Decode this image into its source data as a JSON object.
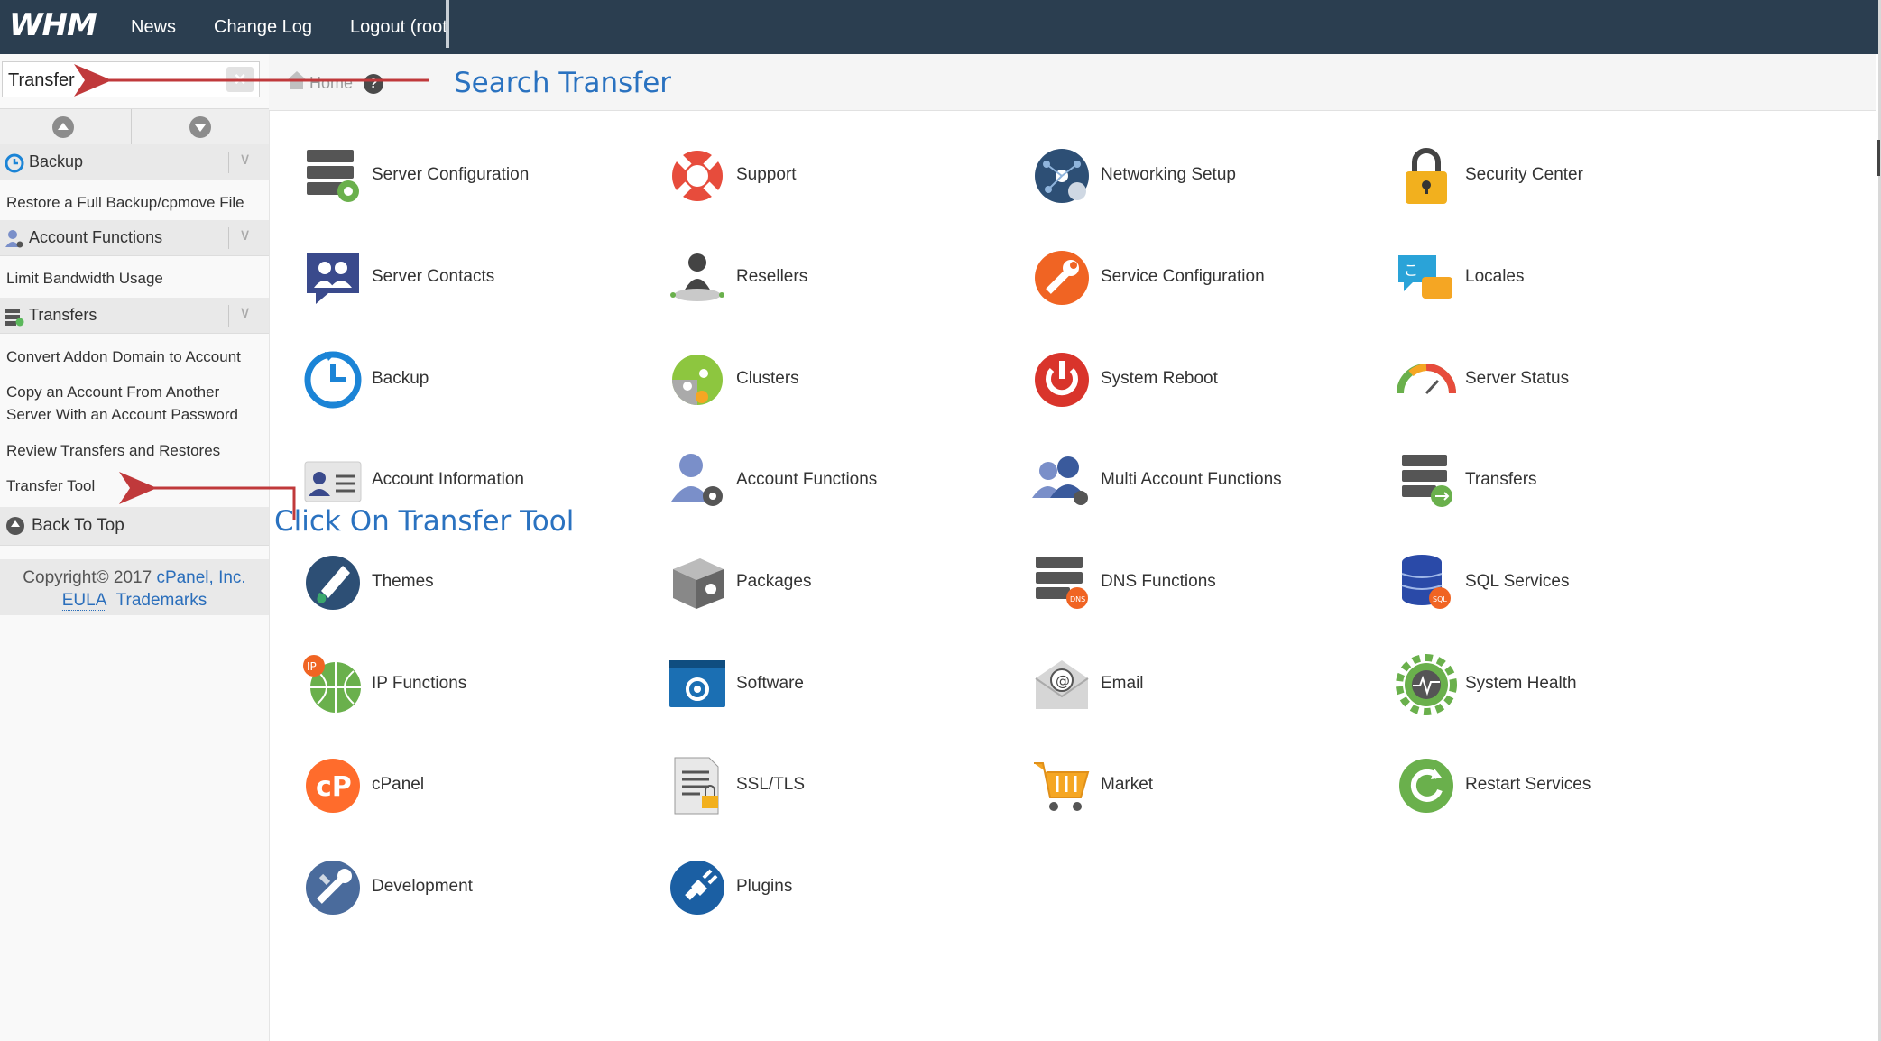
{
  "topbar": {
    "logo": "WHM",
    "nav": [
      "News",
      "Change Log",
      "Logout (root"
    ]
  },
  "search": {
    "value": "Transfer"
  },
  "sidebar": {
    "categories": [
      {
        "label": "Backup",
        "icon": "backup-clock-icon",
        "items": [
          "Restore a Full Backup/cpmove File"
        ]
      },
      {
        "label": "Account Functions",
        "icon": "user-gear-icon",
        "items": [
          "Limit Bandwidth Usage"
        ]
      },
      {
        "label": "Transfers",
        "icon": "transfers-server-icon",
        "items": [
          "Convert Addon Domain to Account",
          "Copy an Account From Another Server With an Account Password",
          "Review Transfers and Restores",
          "Transfer Tool"
        ]
      }
    ],
    "back_to_top": "Back To Top",
    "copyright_text": "Copyright© 2017",
    "copyright_company": "cPanel, Inc.",
    "eula": "EULA",
    "trademarks": "Trademarks"
  },
  "breadcrumb": {
    "home": "Home",
    "help": "?"
  },
  "annotations": {
    "search_hint": "Search Transfer",
    "click_hint": "Click On Transfer Tool"
  },
  "grid": [
    {
      "label": "Server Configuration",
      "icon": "server-gear-icon"
    },
    {
      "label": "Support",
      "icon": "lifebuoy-icon"
    },
    {
      "label": "Networking Setup",
      "icon": "network-globe-icon"
    },
    {
      "label": "Security Center",
      "icon": "padlock-icon"
    },
    {
      "label": "Server Contacts",
      "icon": "contacts-chat-icon"
    },
    {
      "label": "Resellers",
      "icon": "reseller-user-icon"
    },
    {
      "label": "Service Configuration",
      "icon": "wrench-icon"
    },
    {
      "label": "Locales",
      "icon": "locales-speech-icon"
    },
    {
      "label": "Backup",
      "icon": "backup-clock-icon"
    },
    {
      "label": "Clusters",
      "icon": "clusters-icon"
    },
    {
      "label": "System Reboot",
      "icon": "power-icon"
    },
    {
      "label": "Server Status",
      "icon": "gauge-icon"
    },
    {
      "label": "Account Information",
      "icon": "id-card-icon"
    },
    {
      "label": "Account Functions",
      "icon": "user-gear-icon"
    },
    {
      "label": "Multi Account Functions",
      "icon": "users-gear-icon"
    },
    {
      "label": "Transfers",
      "icon": "server-transfer-icon"
    },
    {
      "label": "Themes",
      "icon": "paint-drop-icon"
    },
    {
      "label": "Packages",
      "icon": "package-box-icon"
    },
    {
      "label": "DNS Functions",
      "icon": "dns-server-icon"
    },
    {
      "label": "SQL Services",
      "icon": "database-sql-icon"
    },
    {
      "label": "IP Functions",
      "icon": "ip-globe-icon"
    },
    {
      "label": "Software",
      "icon": "software-window-icon"
    },
    {
      "label": "Email",
      "icon": "email-envelope-icon"
    },
    {
      "label": "System Health",
      "icon": "health-gear-icon"
    },
    {
      "label": "cPanel",
      "icon": "cpanel-logo-icon"
    },
    {
      "label": "SSL/TLS",
      "icon": "ssl-document-icon"
    },
    {
      "label": "Market",
      "icon": "shopping-cart-icon"
    },
    {
      "label": "Restart Services",
      "icon": "restart-arrow-icon"
    },
    {
      "label": "Development",
      "icon": "development-tools-icon"
    },
    {
      "label": "Plugins",
      "icon": "plug-icon"
    }
  ],
  "colors": {
    "topbar": "#2b3e50",
    "annotation": "#2a72c0",
    "arrow": "#c0393b",
    "link": "#2a6ebb"
  }
}
